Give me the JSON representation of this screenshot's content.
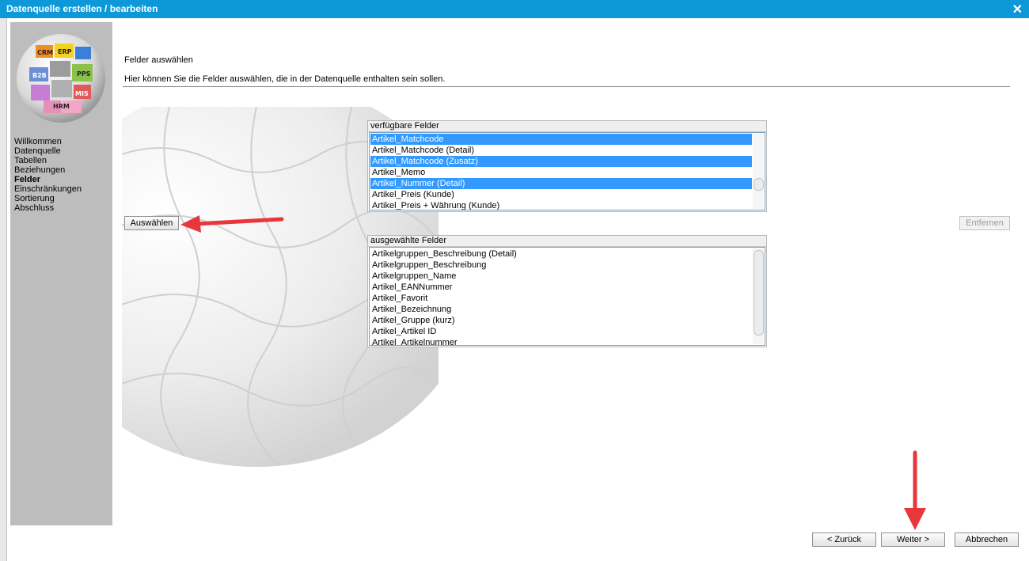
{
  "window": {
    "title": "Datenquelle erstellen / bearbeiten",
    "close_glyph": "✕"
  },
  "logo": {
    "labels": [
      "CRM",
      "ERP",
      "B2B",
      "PPS",
      "HRM",
      "MIS"
    ],
    "icon": "puzzle-globe-logo"
  },
  "sidebar": {
    "items": [
      {
        "label": "Willkommen",
        "active": false
      },
      {
        "label": "Datenquelle",
        "active": false
      },
      {
        "label": "Tabellen",
        "active": false
      },
      {
        "label": "Beziehungen",
        "active": false
      },
      {
        "label": "Felder",
        "active": true
      },
      {
        "label": "Einschränkungen",
        "active": false
      },
      {
        "label": "Sortierung",
        "active": false
      },
      {
        "label": "Abschluss",
        "active": false
      }
    ]
  },
  "main": {
    "heading": "Felder auswählen",
    "description": "Hier können Sie die Felder auswählen, die in der Datenquelle enthalten sein sollen."
  },
  "available": {
    "header": "verfügbare Felder",
    "items": [
      {
        "label": "Artikel_Matchcode",
        "selected": true
      },
      {
        "label": "Artikel_Matchcode (Detail)",
        "selected": false
      },
      {
        "label": "Artikel_Matchcode (Zusatz)",
        "selected": true
      },
      {
        "label": "Artikel_Memo",
        "selected": false
      },
      {
        "label": "Artikel_Nummer (Detail)",
        "selected": true
      },
      {
        "label": "Artikel_Preis (Kunde)",
        "selected": false
      },
      {
        "label": "Artikel_Preis + Währung (Kunde)",
        "selected": false
      }
    ]
  },
  "selected_fields": {
    "header": "ausgewählte Felder",
    "items": [
      "Artikelgruppen_Beschreibung (Detail)",
      "Artikelgruppen_Beschreibung",
      "Artikelgruppen_Name",
      "Artikel_EANNummer",
      "Artikel_Favorit",
      "Artikel_Bezeichnung",
      "Artikel_Gruppe (kurz)",
      "Artikel_Artikel ID",
      "Artikel_Artikelnummer"
    ]
  },
  "buttons": {
    "select": "Auswählen",
    "remove": "Entfernen",
    "back": "< Zurück",
    "next": "Weiter >",
    "cancel": "Abbrechen"
  },
  "colors": {
    "titlebar": "#0d98d9",
    "selection": "#3399ff",
    "sidebar": "#bdbdbd",
    "annotation_arrow": "#e8363c"
  }
}
